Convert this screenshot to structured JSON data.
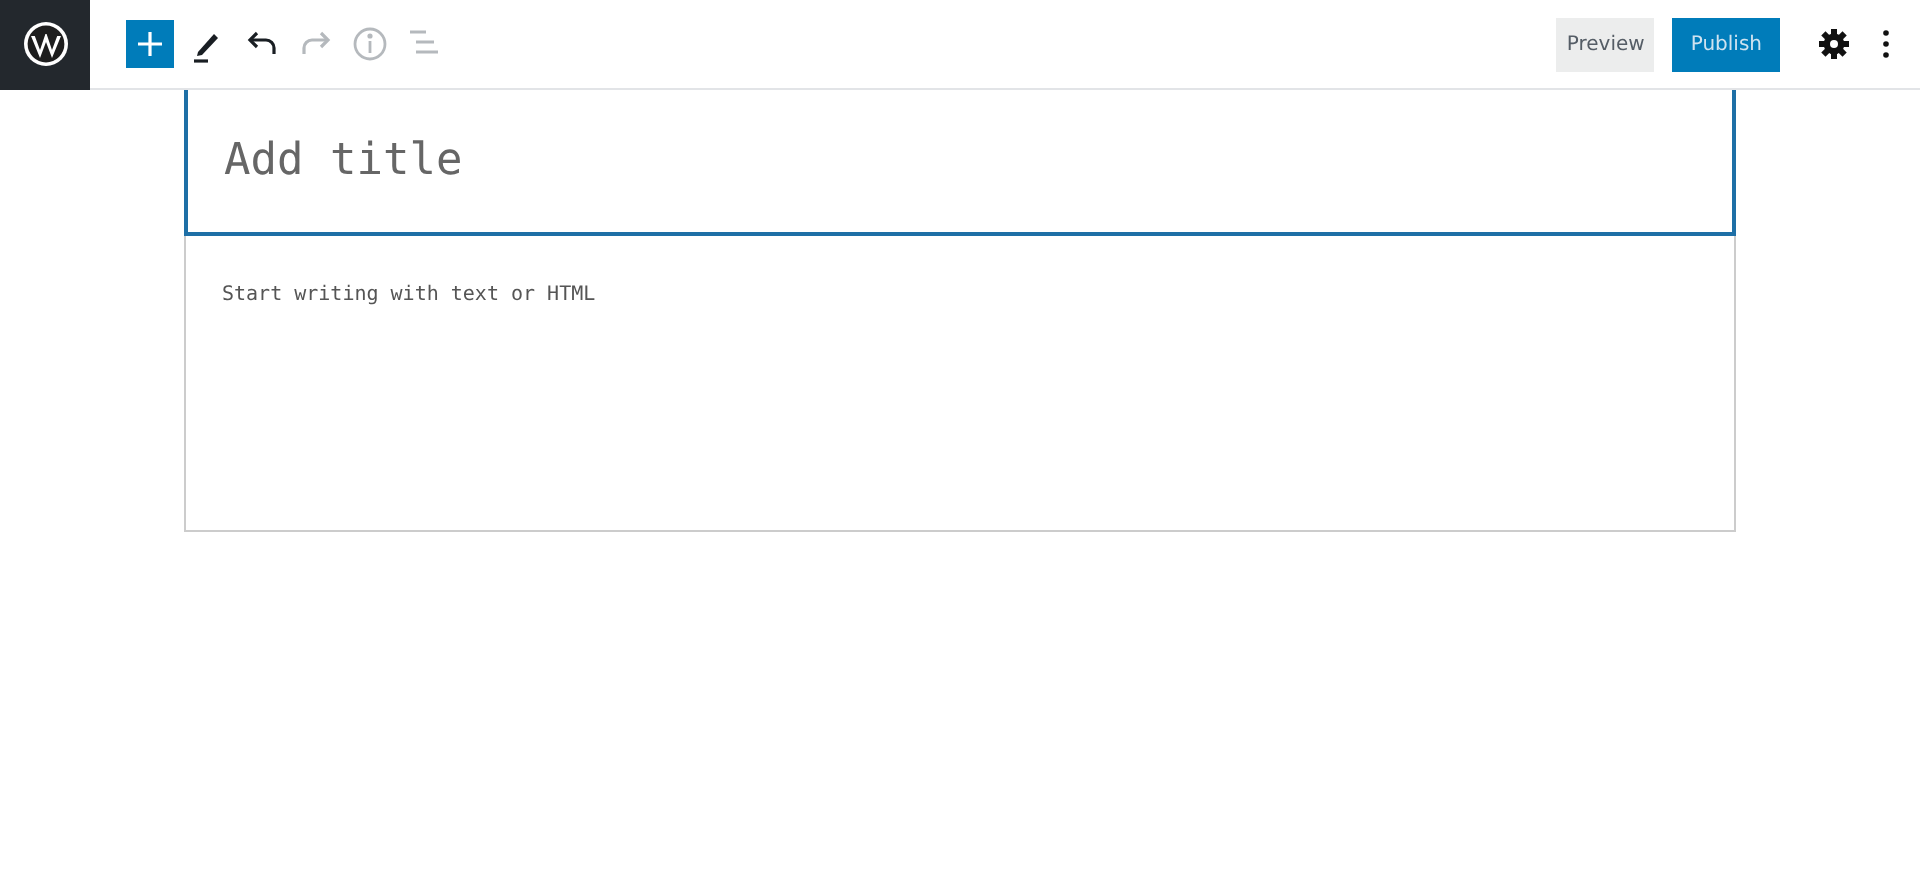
{
  "toolbar": {
    "tools": [
      {
        "kind": "add",
        "disabled": false
      },
      {
        "kind": "edit",
        "disabled": false
      },
      {
        "kind": "undo",
        "disabled": false
      },
      {
        "kind": "redo",
        "disabled": true
      },
      {
        "kind": "info",
        "disabled": true
      },
      {
        "kind": "outline",
        "disabled": true
      }
    ],
    "preview": "Preview",
    "publish": "Publish"
  },
  "editor": {
    "title": {
      "placeholder": "Add title",
      "focused": true
    },
    "content": {
      "placeholder": "Start writing with text or HTML"
    }
  }
}
